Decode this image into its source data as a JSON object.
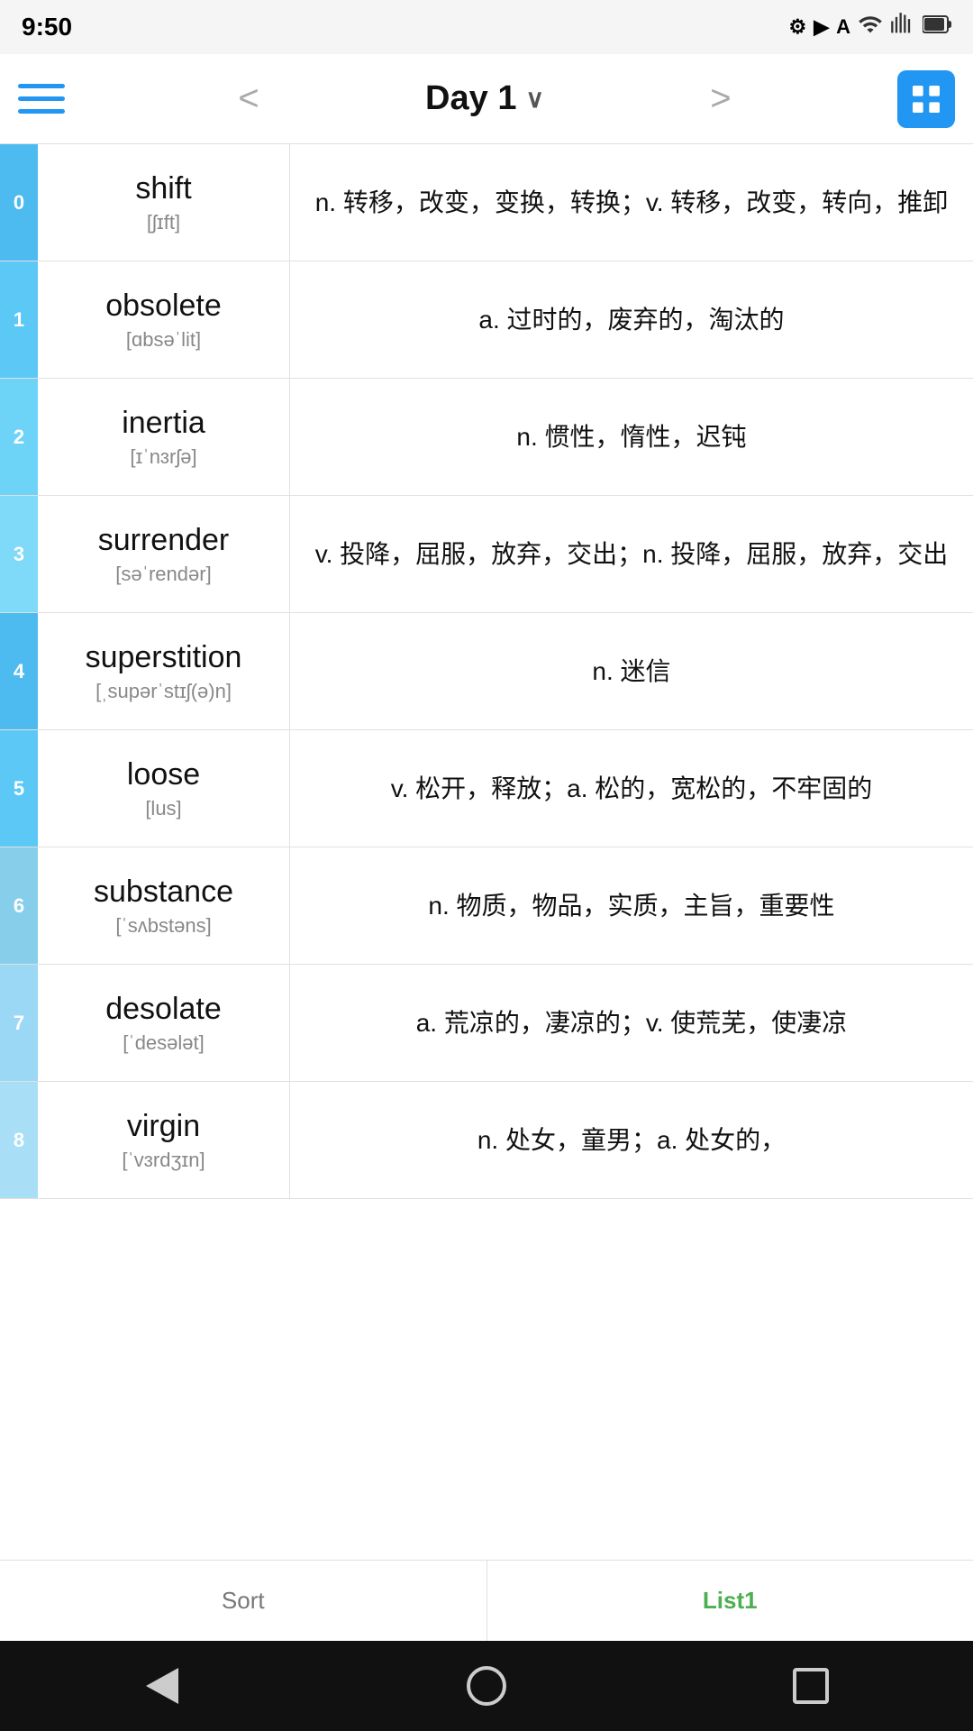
{
  "statusBar": {
    "time": "9:50",
    "icons": [
      "gear",
      "play",
      "text",
      "wifi",
      "dot"
    ]
  },
  "navBar": {
    "title": "Day 1",
    "prevLabel": "<",
    "nextLabel": ">"
  },
  "words": [
    {
      "index": "0",
      "word": "shift",
      "phonetic": "[ʃɪft]",
      "definition": "n. 转移，改变，变换，转换；v. 转移，改变，转向，推卸"
    },
    {
      "index": "1",
      "word": "obsolete",
      "phonetic": "[ɑbsəˈlit]",
      "definition": "a. 过时的，废弃的，淘汰的"
    },
    {
      "index": "2",
      "word": "inertia",
      "phonetic": "[ɪˈnɜrʃə]",
      "definition": "n. 惯性，惰性，迟钝"
    },
    {
      "index": "3",
      "word": "surrender",
      "phonetic": "[səˈrendər]",
      "definition": "v. 投降，屈服，放弃，交出；n. 投降，屈服，放弃，交出"
    },
    {
      "index": "4",
      "word": "superstition",
      "phonetic": "[ˌsupərˈstɪʃ(ə)n]",
      "definition": "n. 迷信"
    },
    {
      "index": "5",
      "word": "loose",
      "phonetic": "[lus]",
      "definition": "v. 松开，释放；a. 松的，宽松的，不牢固的"
    },
    {
      "index": "6",
      "word": "substance",
      "phonetic": "[ˈsʌbstəns]",
      "definition": "n. 物质，物品，实质，主旨，重要性"
    },
    {
      "index": "7",
      "word": "desolate",
      "phonetic": "[ˈdesələt]",
      "definition": "a. 荒凉的，凄凉的；v. 使荒芜，使凄凉"
    },
    {
      "index": "8",
      "word": "virgin",
      "phonetic": "[ˈvɜrdʒɪn]",
      "definition": "n. 处女，童男；a. 处女的，"
    }
  ],
  "bottomTabs": [
    {
      "label": "Sort",
      "active": false
    },
    {
      "label": "List1",
      "active": true
    }
  ],
  "androidNav": {
    "back": "back",
    "home": "home",
    "recent": "recent"
  }
}
